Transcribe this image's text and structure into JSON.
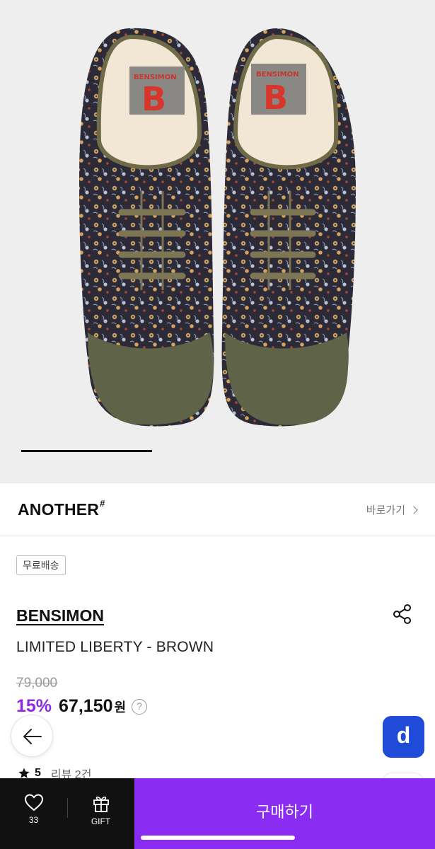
{
  "store": {
    "logo": "ANOTHER",
    "logo_mark": "#",
    "link_label": "바로가기"
  },
  "badge": "무료배송",
  "product": {
    "brand": "BENSIMON",
    "name": "LIMITED LIBERTY - BROWN",
    "original_price": "79,000",
    "discount": "15%",
    "price": "67,150",
    "currency": "원",
    "help": "?"
  },
  "rating": {
    "value": "5",
    "reviews": "리뷰 2건"
  },
  "fab": {
    "d_label": "d"
  },
  "bottom_bar": {
    "like_count": "33",
    "gift_label": "GIFT",
    "buy_label": "구매하기"
  },
  "image_label": "BENSIMON",
  "colors": {
    "accent": "#8a2cf1",
    "discount": "#8c2be0",
    "fab_blue": "#1f4bd8",
    "bar_dark": "#111111"
  },
  "icons": [
    "heart-icon",
    "gift-icon",
    "share-icon",
    "back-arrow-icon",
    "star-icon",
    "help-icon",
    "chevron-right-icon"
  ]
}
